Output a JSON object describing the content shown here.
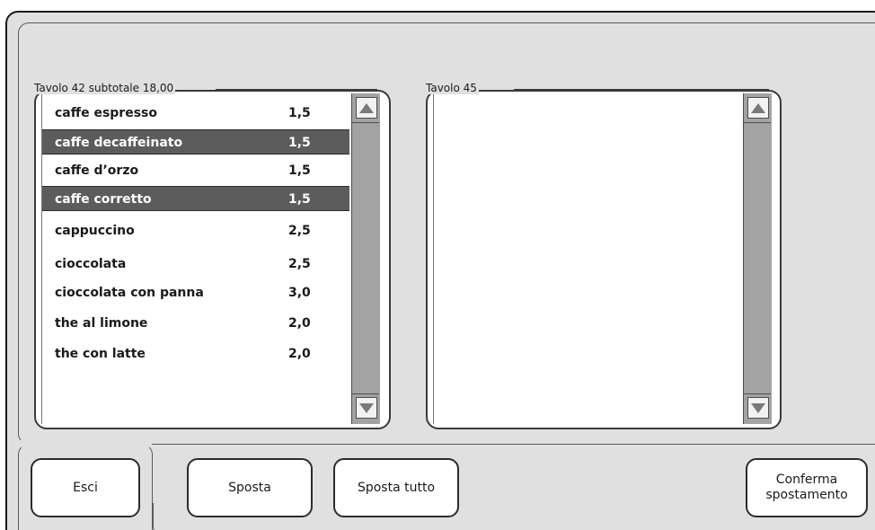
{
  "left_box": {
    "label": "Tavolo 42 subtotale 18,00",
    "items": [
      {
        "name": "caffe espresso",
        "price": "1,5",
        "selected": false
      },
      {
        "name": "caffe decaffeinato",
        "price": "1,5",
        "selected": true
      },
      {
        "name": "caffe d’orzo",
        "price": "1,5",
        "selected": false
      },
      {
        "name": "caffe corretto",
        "price": "1,5",
        "selected": true
      },
      {
        "name": "cappuccino",
        "price": "2,5",
        "selected": false
      },
      {
        "name": "cioccolata",
        "price": "2,5",
        "selected": false
      },
      {
        "name": "cioccolata con panna",
        "price": "3,0",
        "selected": false
      },
      {
        "name": "the al limone",
        "price": "2,0",
        "selected": false
      },
      {
        "name": "the con latte",
        "price": "2,0",
        "selected": false
      }
    ]
  },
  "right_box": {
    "label": "Tavolo 45",
    "items": []
  },
  "buttons": {
    "exit": "Esci",
    "move": "Sposta",
    "move_all": "Sposta tutto",
    "confirm": "Conferma\nspostamento"
  },
  "icons": {
    "scroll_up": "triangle-up-icon",
    "scroll_down": "triangle-down-icon"
  },
  "colors": {
    "panel_bg": "#e0e0e0",
    "selected_row_bg": "#5c5c5c",
    "scrollbar_bg": "#a3a3a3"
  }
}
